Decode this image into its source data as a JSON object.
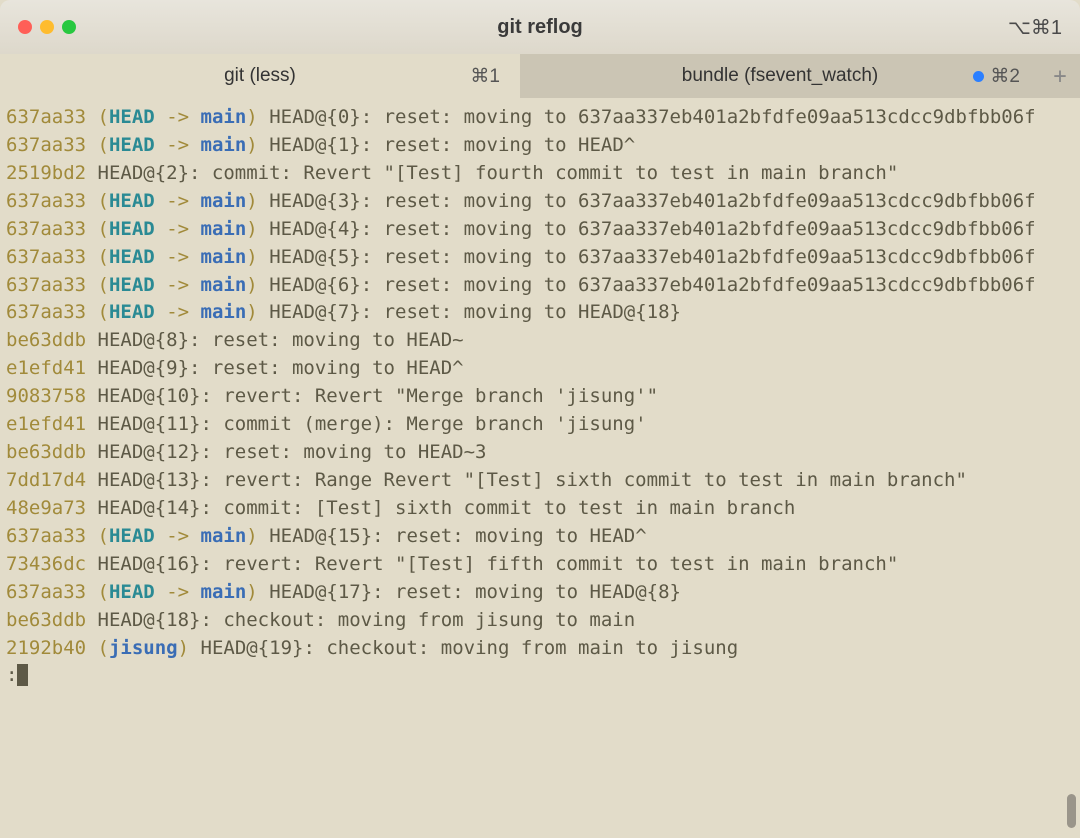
{
  "window": {
    "title": "git reflog",
    "shortcut": "⌥⌘1"
  },
  "tabs": [
    {
      "label": "git (less)",
      "shortcut": "⌘1",
      "active": true,
      "hasDot": false
    },
    {
      "label": "bundle (fsevent_watch)",
      "shortcut": "⌘2",
      "active": false,
      "hasDot": true
    }
  ],
  "newTabGlyph": "+",
  "reflog_lines": [
    {
      "hash": "637aa33",
      "headRef": true,
      "branch": "main",
      "msg": "HEAD@{0}: reset: moving to 637aa337eb401a2bfdfe09aa513cdcc9dbfbb06f"
    },
    {
      "hash": "637aa33",
      "headRef": true,
      "branch": "main",
      "msg": "HEAD@{1}: reset: moving to HEAD^"
    },
    {
      "hash": "2519bd2",
      "headRef": false,
      "msg": "HEAD@{2}: commit: Revert \"[Test] fourth commit to test in main branch\""
    },
    {
      "hash": "637aa33",
      "headRef": true,
      "branch": "main",
      "msg": "HEAD@{3}: reset: moving to 637aa337eb401a2bfdfe09aa513cdcc9dbfbb06f"
    },
    {
      "hash": "637aa33",
      "headRef": true,
      "branch": "main",
      "msg": "HEAD@{4}: reset: moving to 637aa337eb401a2bfdfe09aa513cdcc9dbfbb06f"
    },
    {
      "hash": "637aa33",
      "headRef": true,
      "branch": "main",
      "msg": "HEAD@{5}: reset: moving to 637aa337eb401a2bfdfe09aa513cdcc9dbfbb06f"
    },
    {
      "hash": "637aa33",
      "headRef": true,
      "branch": "main",
      "msg": "HEAD@{6}: reset: moving to 637aa337eb401a2bfdfe09aa513cdcc9dbfbb06f"
    },
    {
      "hash": "637aa33",
      "headRef": true,
      "branch": "main",
      "msg": "HEAD@{7}: reset: moving to HEAD@{18}"
    },
    {
      "hash": "be63ddb",
      "headRef": false,
      "msg": "HEAD@{8}: reset: moving to HEAD~"
    },
    {
      "hash": "e1efd41",
      "headRef": false,
      "msg": "HEAD@{9}: reset: moving to HEAD^"
    },
    {
      "hash": "9083758",
      "headRef": false,
      "msg": "HEAD@{10}: revert: Revert \"Merge branch 'jisung'\""
    },
    {
      "hash": "e1efd41",
      "headRef": false,
      "msg": "HEAD@{11}: commit (merge): Merge branch 'jisung'"
    },
    {
      "hash": "be63ddb",
      "headRef": false,
      "msg": "HEAD@{12}: reset: moving to HEAD~3"
    },
    {
      "hash": "7dd17d4",
      "headRef": false,
      "msg": "HEAD@{13}: revert: Range Revert \"[Test] sixth commit to test in main branch\""
    },
    {
      "hash": "48e9a73",
      "headRef": false,
      "msg": "HEAD@{14}: commit: [Test] sixth commit to test in main branch"
    },
    {
      "hash": "637aa33",
      "headRef": true,
      "branch": "main",
      "msg": "HEAD@{15}: reset: moving to HEAD^"
    },
    {
      "hash": "73436dc",
      "headRef": false,
      "msg": "HEAD@{16}: revert: Revert \"[Test] fifth commit to test in main branch\""
    },
    {
      "hash": "637aa33",
      "headRef": true,
      "branch": "main",
      "msg": "HEAD@{17}: reset: moving to HEAD@{8}"
    },
    {
      "hash": "be63ddb",
      "headRef": false,
      "msg": "HEAD@{18}: checkout: moving from jisung to main"
    },
    {
      "hash": "2192b40",
      "headRef": false,
      "branchOnly": "jisung",
      "msg": "HEAD@{19}: checkout: moving from main to jisung"
    }
  ],
  "prompt": ":",
  "headLabel": "HEAD",
  "arrowText": " -> "
}
